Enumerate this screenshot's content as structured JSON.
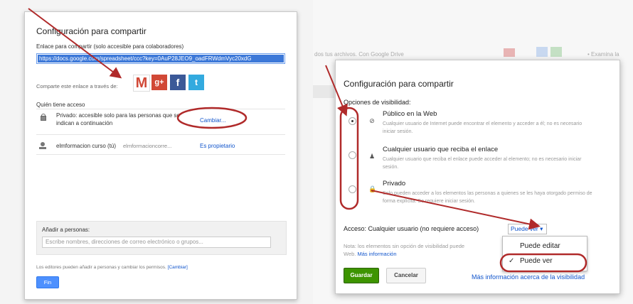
{
  "left_dialog": {
    "title": "Configuración para compartir",
    "link_label": "Enlace para compartir (solo accesible para colaboradores)",
    "share_url": "https://docs.google.com/spreadsheet/ccc?key=0AuP28JEO9_oadFRWdmVyc20xdG",
    "share_via_label": "Comparte este enlace a través de:",
    "social_icons": [
      "gmail-icon",
      "google-plus-icon",
      "facebook-icon",
      "twitter-icon"
    ],
    "who_has_access_label": "Quién tiene acceso",
    "private_text": "Privado: accesible solo para las personas que se indican a continuación",
    "change_link": "Cambiar...",
    "owner_name": "elmformacion curso (tú)",
    "owner_email": "elmformacioncorre...",
    "owner_role": "Es propietario",
    "add_people_label": "Añadir a personas:",
    "add_people_placeholder": "Escribe nombres, direcciones de correo electrónico o grupos...",
    "editors_note": "Los editores pueden añadir a personas y cambiar los permisos.",
    "editors_note_link": "[Cambiar]",
    "done_button": "Fin"
  },
  "background": {
    "drive_text": "dos tus archivos. Con Google Drive",
    "side_text": "• Examina la"
  },
  "right_dialog": {
    "title": "Configuración para compartir",
    "visibility_label": "Opciones de visibilidad:",
    "options": [
      {
        "title": "Público en la Web",
        "desc": "Cualquier usuario de Internet puede encontrar el elemento y acceder a él; no es necesario iniciar sesión.",
        "selected": true,
        "icon": "globe-icon"
      },
      {
        "title": "Cualquier usuario que reciba el enlace",
        "desc": "Cualquier usuario que reciba el enlace puede acceder al elemento; no es necesario iniciar sesión.",
        "selected": false,
        "icon": "people-icon"
      },
      {
        "title": "Privado",
        "desc": "Solo pueden acceder a los elementos las personas a quienes se les haya otorgado permiso de forma explícita. Se requiere iniciar sesión.",
        "selected": false,
        "icon": "lock-icon"
      }
    ],
    "access_label": "Acceso:  Cualquier usuario (no requiere acceso)",
    "access_value": "Puede ver",
    "note_text": "Nota: los elementos sin opción de visibilidad puede",
    "note_text2": "Web.",
    "note_link": "Más información",
    "save_button": "Guardar",
    "cancel_button": "Cancelar",
    "more_link": "Más información acerca de la visibilidad",
    "menu_items": [
      "Puede editar",
      "Puede ver"
    ],
    "menu_checked": "Puede ver"
  },
  "colors": {
    "annotation": "#b02a2a",
    "link": "#1155cc",
    "save_green": "#3d9400",
    "done_blue": "#4d90fe"
  }
}
